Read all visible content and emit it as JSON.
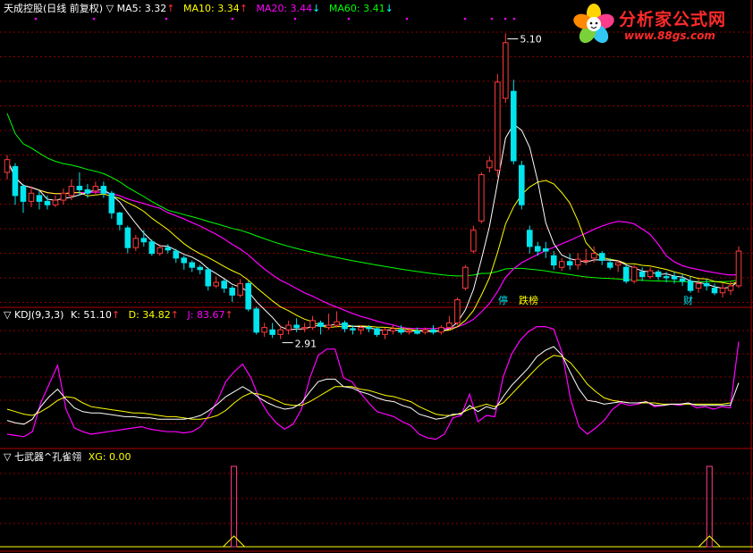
{
  "main_panel": {
    "stock_name": "天成控股(日线 前复权)",
    "ma_indicators": [
      {
        "label": "MA5: 3.32",
        "color": "#ffffff",
        "arrow": "↑",
        "arrow_color": "#ff3030"
      },
      {
        "label": "MA10: 3.34",
        "color": "#ffff00",
        "arrow": "↑",
        "arrow_color": "#ff3030"
      },
      {
        "label": "MA20: 3.44",
        "color": "#ff00ff",
        "arrow": "↓",
        "arrow_color": "#00ffff"
      },
      {
        "label": "MA60: 3.41",
        "color": "#00ff00",
        "arrow": "↓",
        "arrow_color": "#00ffff"
      }
    ],
    "high_label": "5.10",
    "low_label": "2.91",
    "event_markers": [
      "停",
      "跌榜",
      "财"
    ]
  },
  "kdj_panel": {
    "title": "KDJ(9,3,3)",
    "indicators": [
      {
        "label": "K: 51.10",
        "color": "#ffffff",
        "arrow": "↑"
      },
      {
        "label": "D: 34.82",
        "color": "#ffff00",
        "arrow": "↑"
      },
      {
        "label": "J: 83.67",
        "color": "#ff00ff",
        "arrow": "↑"
      }
    ]
  },
  "xg_panel": {
    "title": "七武器^孔雀翎",
    "indicators": [
      {
        "label": "XG: 0.00",
        "color": "#ffff00"
      }
    ]
  },
  "logo": {
    "name": "分析家公式网",
    "url": "www.88gs.com"
  },
  "colors": {
    "up": "#ff3b3b",
    "down": "#00e5ee",
    "ma5": "#ffffff",
    "ma10": "#ffff00",
    "ma20": "#ff00ff",
    "ma60": "#00ff00",
    "grid": "#8b0000"
  },
  "chart_data": {
    "type": "candlestick",
    "price_range": [
      2.75,
      5.25
    ],
    "candles": [
      [
        3.9,
        4.01,
        3.84,
        4.05
      ],
      [
        3.95,
        3.7,
        3.62,
        3.98
      ],
      [
        3.78,
        3.65,
        3.55,
        3.8
      ],
      [
        3.65,
        3.72,
        3.6,
        3.78
      ],
      [
        3.7,
        3.65,
        3.58,
        3.74
      ],
      [
        3.65,
        3.62,
        3.58,
        3.7
      ],
      [
        3.62,
        3.66,
        3.6,
        3.7
      ],
      [
        3.66,
        3.72,
        3.62,
        3.76
      ],
      [
        3.7,
        3.78,
        3.66,
        3.84
      ],
      [
        3.78,
        3.75,
        3.7,
        3.9
      ],
      [
        3.75,
        3.72,
        3.68,
        3.8
      ],
      [
        3.74,
        3.78,
        3.7,
        3.82
      ],
      [
        3.78,
        3.72,
        3.68,
        3.82
      ],
      [
        3.72,
        3.55,
        3.5,
        3.74
      ],
      [
        3.55,
        3.45,
        3.4,
        3.56
      ],
      [
        3.42,
        3.25,
        3.2,
        3.44
      ],
      [
        3.25,
        3.33,
        3.22,
        3.36
      ],
      [
        3.33,
        3.3,
        3.26,
        3.4
      ],
      [
        3.3,
        3.2,
        3.18,
        3.32
      ],
      [
        3.2,
        3.25,
        3.18,
        3.28
      ],
      [
        3.25,
        3.23,
        3.2,
        3.28
      ],
      [
        3.22,
        3.16,
        3.12,
        3.24
      ],
      [
        3.16,
        3.12,
        3.06,
        3.18
      ],
      [
        3.12,
        3.08,
        3.04,
        3.14
      ],
      [
        3.08,
        3.06,
        3.02,
        3.1
      ],
      [
        3.06,
        2.92,
        2.88,
        3.08
      ],
      [
        2.92,
        2.95,
        2.9,
        3.0
      ],
      [
        2.96,
        2.9,
        2.86,
        2.98
      ],
      [
        2.9,
        2.84,
        2.78,
        2.92
      ],
      [
        2.84,
        2.94,
        2.82,
        2.98
      ],
      [
        2.94,
        2.72,
        2.7,
        2.96
      ],
      [
        2.72,
        2.52,
        2.5,
        2.74
      ],
      [
        2.52,
        2.56,
        2.48,
        2.6
      ],
      [
        2.54,
        2.5,
        2.47,
        2.6
      ],
      [
        2.5,
        2.54,
        2.46,
        2.58
      ],
      [
        2.54,
        2.58,
        2.5,
        2.62
      ],
      [
        2.58,
        2.56,
        2.52,
        2.64
      ],
      [
        2.55,
        2.56,
        2.52,
        2.6
      ],
      [
        2.56,
        2.62,
        2.54,
        2.66
      ],
      [
        2.6,
        2.57,
        2.5,
        2.62
      ],
      [
        2.56,
        2.58,
        2.54,
        2.68
      ],
      [
        2.58,
        2.61,
        2.56,
        2.7
      ],
      [
        2.6,
        2.55,
        2.52,
        2.62
      ],
      [
        2.55,
        2.54,
        2.5,
        2.58
      ],
      [
        2.54,
        2.56,
        2.5,
        2.58
      ],
      [
        2.56,
        2.55,
        2.52,
        2.58
      ],
      [
        2.55,
        2.5,
        2.48,
        2.56
      ],
      [
        2.5,
        2.54,
        2.46,
        2.56
      ],
      [
        2.53,
        2.55,
        2.5,
        2.58
      ],
      [
        2.54,
        2.52,
        2.5,
        2.58
      ],
      [
        2.52,
        2.53,
        2.5,
        2.56
      ],
      [
        2.53,
        2.51,
        2.5,
        2.56
      ],
      [
        2.52,
        2.54,
        2.5,
        2.56
      ],
      [
        2.54,
        2.52,
        2.5,
        2.58
      ],
      [
        2.52,
        2.56,
        2.5,
        2.58
      ],
      [
        2.56,
        2.6,
        2.54,
        2.66
      ],
      [
        2.6,
        2.8,
        2.58,
        2.82
      ],
      [
        2.9,
        3.08,
        2.88,
        3.1
      ],
      [
        3.22,
        3.4,
        3.2,
        3.44
      ],
      [
        3.48,
        3.88,
        3.46,
        3.9
      ],
      [
        3.94,
        4.0,
        3.9,
        4.04
      ],
      [
        3.92,
        4.68,
        3.86,
        4.75
      ],
      [
        4.54,
        5.02,
        4.5,
        5.1
      ],
      [
        4.6,
        4.0,
        3.97,
        4.7
      ],
      [
        3.96,
        3.62,
        3.58,
        4.0
      ],
      [
        3.4,
        3.26,
        3.2,
        3.44
      ],
      [
        3.26,
        3.22,
        3.18,
        3.3
      ],
      [
        3.24,
        3.22,
        3.16,
        3.3
      ],
      [
        3.18,
        3.1,
        3.06,
        3.22
      ],
      [
        3.08,
        3.13,
        3.05,
        3.16
      ],
      [
        3.13,
        3.1,
        3.06,
        3.2
      ],
      [
        3.1,
        3.15,
        3.06,
        3.2
      ],
      [
        3.14,
        3.14,
        3.1,
        3.24
      ],
      [
        3.16,
        3.2,
        3.12,
        3.26
      ],
      [
        3.2,
        3.14,
        3.1,
        3.22
      ],
      [
        3.12,
        3.08,
        3.06,
        3.16
      ],
      [
        3.1,
        3.12,
        3.04,
        3.14
      ],
      [
        3.08,
        2.96,
        2.94,
        3.1
      ],
      [
        2.96,
        3.08,
        2.94,
        3.1
      ],
      [
        3.04,
        3.0,
        2.96,
        3.08
      ],
      [
        3.0,
        3.05,
        2.98,
        3.08
      ],
      [
        3.04,
        3.0,
        2.97,
        3.06
      ],
      [
        3.0,
        2.99,
        2.95,
        3.04
      ],
      [
        3.0,
        2.98,
        2.94,
        3.04
      ],
      [
        2.98,
        2.96,
        2.92,
        3.02
      ],
      [
        2.96,
        2.88,
        2.86,
        3.0
      ],
      [
        2.9,
        2.94,
        2.86,
        2.98
      ],
      [
        2.94,
        2.92,
        2.88,
        2.98
      ],
      [
        2.9,
        2.86,
        2.84,
        2.94
      ],
      [
        2.86,
        2.9,
        2.82,
        2.94
      ],
      [
        2.88,
        2.92,
        2.84,
        2.96
      ],
      [
        2.92,
        3.22,
        2.9,
        3.26
      ]
    ],
    "x_range": [
      0,
      100
    ],
    "kdj": {
      "K": [
        21,
        19,
        18,
        22,
        32,
        40,
        46,
        38,
        31,
        28,
        27,
        27,
        26,
        25,
        24,
        24,
        23,
        23,
        22,
        22,
        22,
        22,
        23,
        25,
        29,
        34,
        40,
        44,
        48,
        44,
        39,
        35,
        32,
        30,
        31,
        35,
        44,
        52,
        54,
        54,
        48,
        47,
        44,
        42,
        39,
        37,
        36,
        33,
        31,
        26,
        24,
        22,
        23,
        26,
        26,
        33,
        28,
        32,
        30,
        40,
        49,
        56,
        63,
        72,
        77,
        80,
        73,
        59,
        46,
        37,
        36,
        34,
        35,
        36,
        35,
        35,
        36,
        33,
        33,
        34,
        34,
        35,
        33,
        33,
        33,
        33,
        33,
        51
      ],
      "D": [
        30,
        28,
        26,
        25,
        28,
        32,
        37,
        40,
        39,
        35,
        32,
        31,
        30,
        29,
        28,
        27,
        27,
        26,
        25,
        24,
        24,
        23,
        22,
        22,
        23,
        25,
        29,
        35,
        40,
        43,
        42,
        40,
        37,
        34,
        33,
        33,
        36,
        40,
        44,
        48,
        48,
        48,
        46,
        45,
        43,
        41,
        40,
        38,
        36,
        32,
        29,
        26,
        25,
        25,
        27,
        30,
        32,
        34,
        32,
        35,
        42,
        49,
        56,
        63,
        69,
        73,
        72,
        67,
        59,
        50,
        44,
        39,
        37,
        36,
        35,
        35,
        35,
        35,
        34,
        34,
        34,
        34,
        34,
        34,
        34,
        34,
        35
      ],
      "J": [
        10,
        9,
        8,
        12,
        35,
        50,
        65,
        30,
        15,
        12,
        10,
        11,
        12,
        13,
        14,
        15,
        16,
        14,
        13,
        12,
        12,
        11,
        12,
        16,
        25,
        37,
        52,
        60,
        66,
        55,
        38,
        27,
        19,
        14,
        18,
        30,
        55,
        73,
        78,
        78,
        55,
        52,
        43,
        35,
        28,
        26,
        24,
        20,
        17,
        10,
        7,
        6,
        10,
        23,
        25,
        42,
        20,
        25,
        24,
        56,
        74,
        85,
        92,
        96,
        96,
        94,
        75,
        38,
        16,
        10,
        15,
        21,
        30,
        35,
        33,
        34,
        36,
        32,
        33,
        34,
        33,
        35,
        31,
        32,
        30,
        32,
        31,
        84
      ]
    },
    "xg": {
      "signals_at": [
        31,
        96
      ],
      "value": 0.0
    }
  }
}
